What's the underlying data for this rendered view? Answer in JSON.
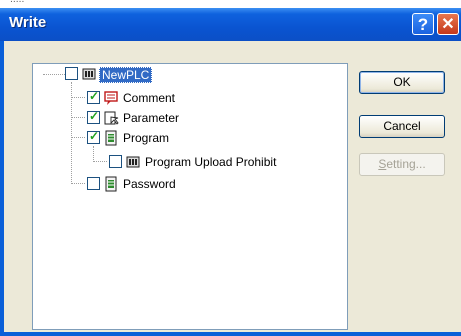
{
  "window": {
    "title": "Write"
  },
  "tree": {
    "root": {
      "label": "NewPLC",
      "checked": false,
      "icon": "plc-device-icon"
    },
    "comment": {
      "label": "Comment",
      "checked": true,
      "icon": "comment-icon"
    },
    "parameter": {
      "label": "Parameter",
      "checked": true,
      "icon": "parameter-icon"
    },
    "program": {
      "label": "Program",
      "checked": true,
      "icon": "program-icon"
    },
    "upload_prohibit": {
      "label": "Program Upload Prohibit",
      "checked": false,
      "icon": "plc-device-icon"
    },
    "password": {
      "label": "Password",
      "checked": false,
      "icon": "password-icon"
    }
  },
  "buttons": {
    "ok": "OK",
    "cancel": "Cancel",
    "setting_first": "S",
    "setting_rest": "etting...",
    "setting_enabled": false
  },
  "colors": {
    "titlebar": "#0a54d1",
    "selection": "#316ac5",
    "dialog_bg": "#ece9d8",
    "check": "#21a121"
  }
}
